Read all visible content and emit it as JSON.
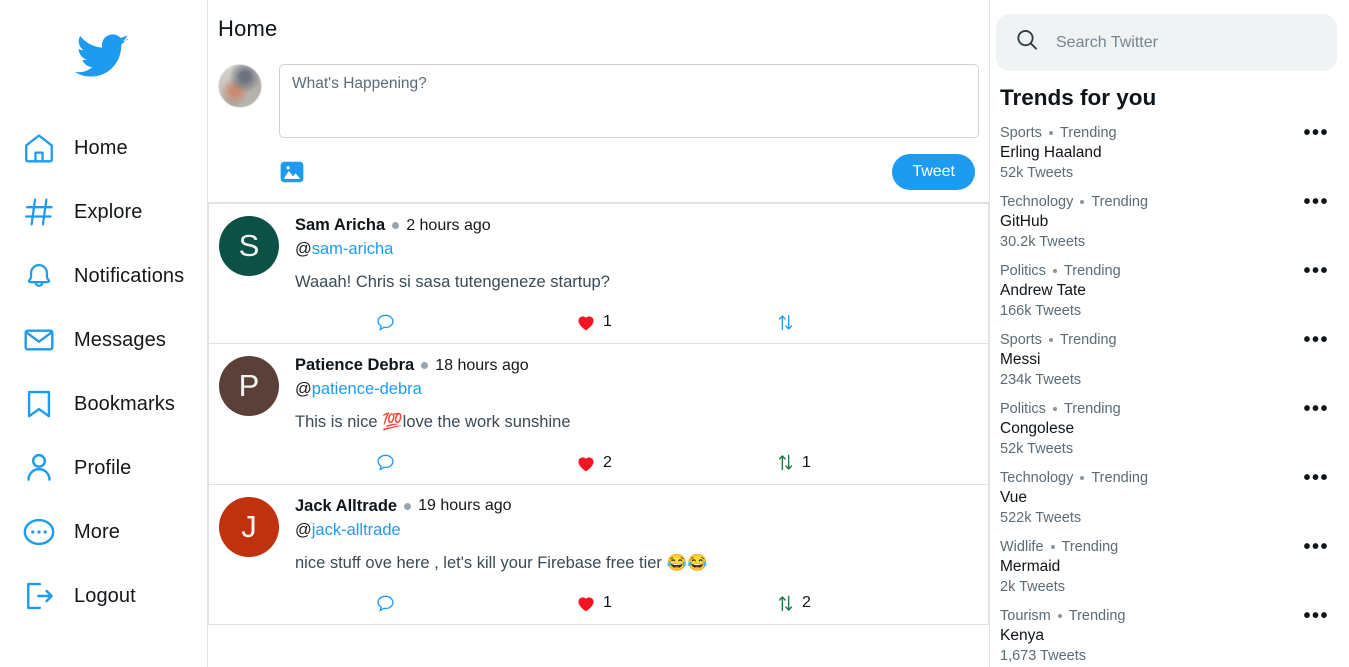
{
  "brand": {
    "logo_icon": "twitter-bird-icon",
    "accent": "#1d9bf0"
  },
  "sidebar": {
    "items": [
      {
        "label": "Home",
        "icon": "home-icon"
      },
      {
        "label": "Explore",
        "icon": "hash-icon"
      },
      {
        "label": "Notifications",
        "icon": "bell-icon"
      },
      {
        "label": "Messages",
        "icon": "envelope-icon"
      },
      {
        "label": "Bookmarks",
        "icon": "bookmark-icon"
      },
      {
        "label": "Profile",
        "icon": "person-icon"
      },
      {
        "label": "More",
        "icon": "ellipsis-circle-icon"
      },
      {
        "label": "Logout",
        "icon": "logout-icon"
      }
    ]
  },
  "feed": {
    "title": "Home",
    "composer": {
      "placeholder": "What's Happening?",
      "value": "",
      "image_icon": "image-icon",
      "tweet_button": "Tweet"
    },
    "tweets": [
      {
        "name": "Sam Aricha",
        "initial": "S",
        "avatar_color": "#0b5145",
        "time": "2 hours ago",
        "handle": "@",
        "handle_link": "sam-aricha",
        "text": "Waaah! Chris si sasa tutengeneze startup?",
        "reply_icon": "comment-icon",
        "reply_count": "",
        "like_icon": "heart-icon",
        "like_count": "1",
        "retweet_icon": "retweet-icon",
        "retweet_count": "",
        "retweet_color": "#1d9bf0"
      },
      {
        "name": "Patience Debra",
        "initial": "P",
        "avatar_color": "#5a4038",
        "time": "18 hours ago",
        "handle": "@",
        "handle_link": "patience-debra",
        "text": "This is nice 💯love the work sunshine",
        "reply_icon": "comment-icon",
        "reply_count": "",
        "like_icon": "heart-icon",
        "like_count": "2",
        "retweet_icon": "retweet-icon",
        "retweet_count": "1",
        "retweet_color": "#1a7a43"
      },
      {
        "name": "Jack Alltrade",
        "initial": "J",
        "avatar_color": "#c0310e",
        "time": "19 hours ago",
        "handle": "@",
        "handle_link": "jack-alltrade",
        "text": "nice stuff ove here , let's kill your Firebase free tier 😂😂",
        "reply_icon": "comment-icon",
        "reply_count": "",
        "like_icon": "heart-icon",
        "like_count": "1",
        "retweet_icon": "retweet-icon",
        "retweet_count": "2",
        "retweet_color": "#1a7a43"
      }
    ]
  },
  "right": {
    "search": {
      "placeholder": "Search Twitter",
      "value": "",
      "icon": "search-icon"
    },
    "trends_title": "Trends for you",
    "trends": [
      {
        "category": "Sports",
        "status": "Trending",
        "name": "Erling Haaland",
        "count": "52k Tweets",
        "more": "•••"
      },
      {
        "category": "Technology",
        "status": "Trending",
        "name": "GitHub",
        "count": "30.2k Tweets",
        "more": "•••"
      },
      {
        "category": "Politics",
        "status": "Trending",
        "name": "Andrew Tate",
        "count": "166k Tweets",
        "more": "•••"
      },
      {
        "category": "Sports",
        "status": "Trending",
        "name": "Messi",
        "count": "234k Tweets",
        "more": "•••"
      },
      {
        "category": "Politics",
        "status": "Trending",
        "name": "Congolese",
        "count": "52k Tweets",
        "more": "•••"
      },
      {
        "category": "Technology",
        "status": "Trending",
        "name": "Vue",
        "count": "522k Tweets",
        "more": "•••"
      },
      {
        "category": "Widlife",
        "status": "Trending",
        "name": "Mermaid",
        "count": "2k Tweets",
        "more": "•••"
      },
      {
        "category": "Tourism",
        "status": "Trending",
        "name": "Kenya",
        "count": "1,673 Tweets",
        "more": "•••"
      }
    ]
  }
}
